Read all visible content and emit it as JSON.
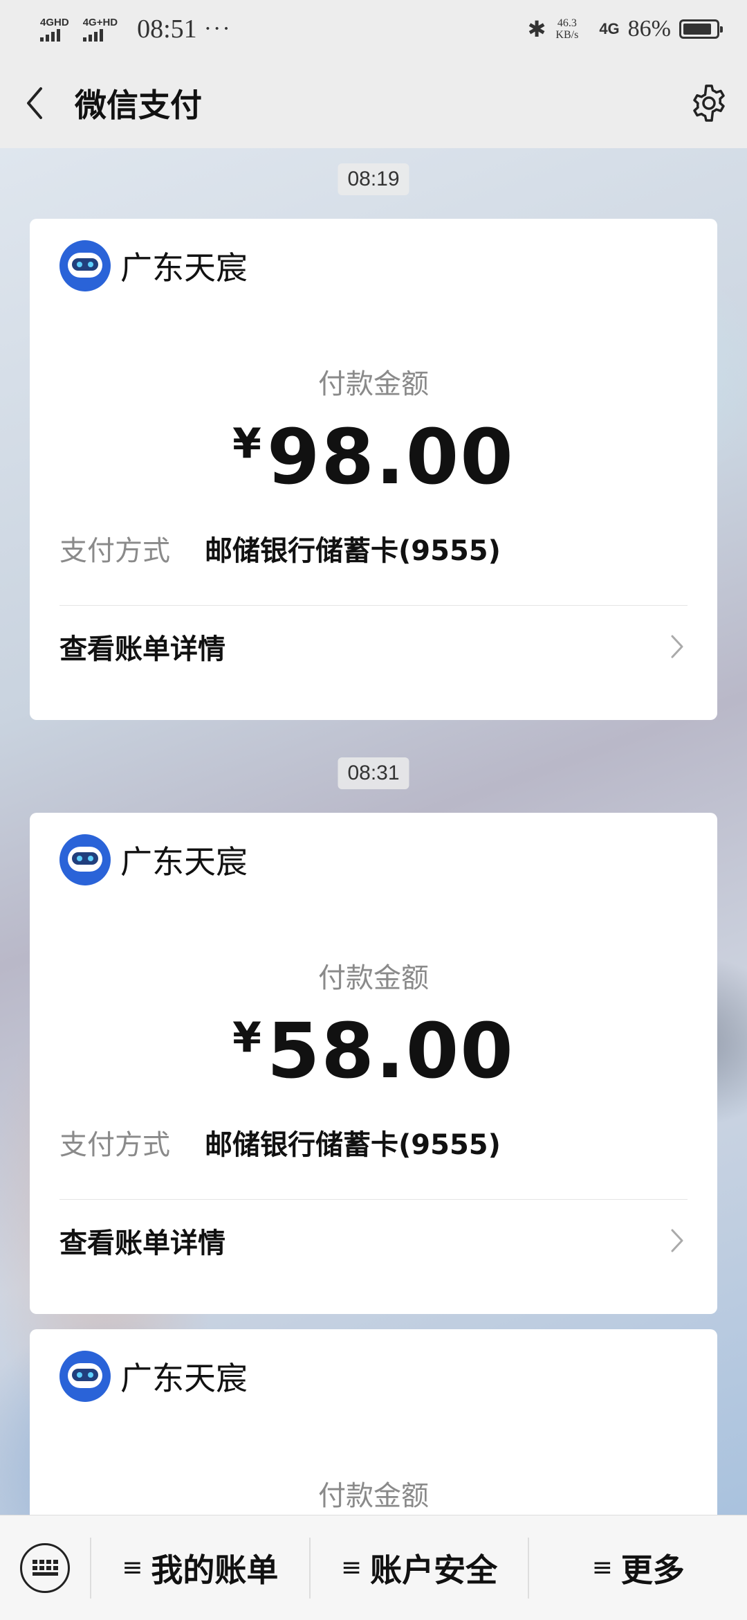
{
  "status_bar": {
    "signal_1_label": "4GHD",
    "signal_2_label": "4G+HD",
    "time": "08:51",
    "dots": "···",
    "bluetooth_icon": "bluetooth-icon",
    "speed_value": "46.3",
    "speed_unit": "KB/s",
    "network": "4G",
    "battery_percent": "86%",
    "battery_level": 0.86
  },
  "nav": {
    "title": "微信支付",
    "back_icon": "chevron-left-icon",
    "settings_icon": "gear-icon"
  },
  "messages": [
    {
      "time": "08:19",
      "merchant": "广东天宸",
      "amount_label": "付款金额",
      "currency": "¥",
      "amount": "98.00",
      "method_label": "支付方式",
      "method_value": "邮储银行储蓄卡(9555)",
      "detail_label": "查看账单详情"
    },
    {
      "time": "08:31",
      "merchant": "广东天宸",
      "amount_label": "付款金额",
      "currency": "¥",
      "amount": "58.00",
      "method_label": "支付方式",
      "method_value": "邮储银行储蓄卡(9555)",
      "detail_label": "查看账单详情"
    },
    {
      "merchant": "广东天宸",
      "amount_label": "付款金额"
    }
  ],
  "bottom_bar": {
    "keyboard_icon": "keyboard-icon",
    "menu_icon": "≡",
    "items": [
      {
        "label": "我的账单"
      },
      {
        "label": "账户安全"
      },
      {
        "label": "更多"
      }
    ]
  }
}
